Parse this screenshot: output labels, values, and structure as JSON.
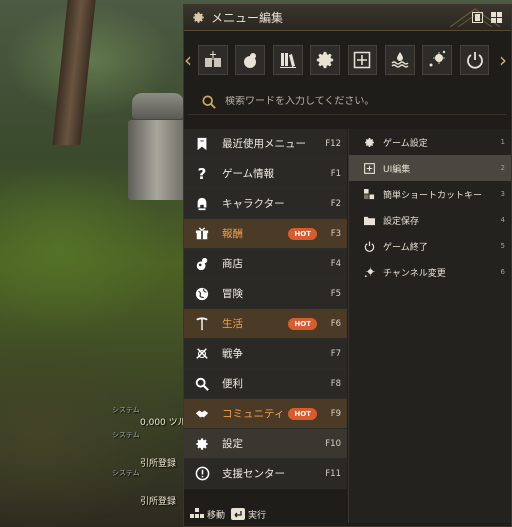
{
  "window": {
    "title": "メニュー編集"
  },
  "toolbar": {
    "buttons": [
      {
        "icon": "book-sword-icon"
      },
      {
        "icon": "shop-bag-icon"
      },
      {
        "icon": "library-icon"
      },
      {
        "icon": "gear-icon"
      },
      {
        "icon": "ui-edit-icon"
      },
      {
        "icon": "water-icon"
      },
      {
        "icon": "channel-icon"
      },
      {
        "icon": "power-icon"
      }
    ]
  },
  "search": {
    "placeholder": "検索ワードを入力してください。"
  },
  "categories": [
    {
      "label": "最近使用メニュー",
      "key": "F12",
      "icon": "bookmark-icon",
      "hot": false,
      "highlight": false
    },
    {
      "label": "ゲーム情報",
      "key": "F1",
      "icon": "question-icon",
      "hot": false,
      "highlight": false
    },
    {
      "label": "キャラクター",
      "key": "F2",
      "icon": "helmet-icon",
      "hot": false,
      "highlight": false
    },
    {
      "label": "報酬",
      "key": "F3",
      "icon": "gift-icon",
      "hot": true,
      "highlight": true
    },
    {
      "label": "商店",
      "key": "F4",
      "icon": "shop-icon",
      "hot": false,
      "highlight": false
    },
    {
      "label": "冒険",
      "key": "F5",
      "icon": "globe-icon",
      "hot": false,
      "highlight": false
    },
    {
      "label": "生活",
      "key": "F6",
      "icon": "pickaxe-icon",
      "hot": true,
      "highlight": true
    },
    {
      "label": "戦争",
      "key": "F7",
      "icon": "crossed-swords-icon",
      "hot": false,
      "highlight": false
    },
    {
      "label": "便利",
      "key": "F8",
      "icon": "magnifier-icon",
      "hot": false,
      "highlight": false
    },
    {
      "label": "コミュニティ",
      "key": "F9",
      "icon": "handshake-icon",
      "hot": true,
      "highlight": true
    },
    {
      "label": "設定",
      "key": "F10",
      "icon": "settings-gear-icon",
      "hot": false,
      "highlight": false,
      "selected": true
    },
    {
      "label": "支援センター",
      "key": "F11",
      "icon": "help-center-icon",
      "hot": false,
      "highlight": false
    }
  ],
  "hot_label": "HOT",
  "subitems": [
    {
      "label": "ゲーム設定",
      "num": "1",
      "icon": "gear-icon"
    },
    {
      "label": "UI編集",
      "num": "2",
      "icon": "ui-edit-icon",
      "selected": true
    },
    {
      "label": "簡単ショートカットキー",
      "num": "3",
      "icon": "shortcut-icon"
    },
    {
      "label": "設定保存",
      "num": "4",
      "icon": "folder-icon"
    },
    {
      "label": "ゲーム終了",
      "num": "5",
      "icon": "power-icon"
    },
    {
      "label": "チャンネル変更",
      "num": "6",
      "icon": "channel-icon"
    }
  ],
  "footer": {
    "move_label": "移動",
    "execute_label": "実行"
  },
  "chat": [
    {
      "sys": "システム",
      "text": "0,000 ツル"
    },
    {
      "sys": "システム",
      "text": "引所登録"
    },
    {
      "sys": "システム",
      "text": "引所登録"
    }
  ],
  "colors": {
    "accent": "#d4b25e",
    "hot": "#d85c2e",
    "hot_text": "#f2a050"
  }
}
